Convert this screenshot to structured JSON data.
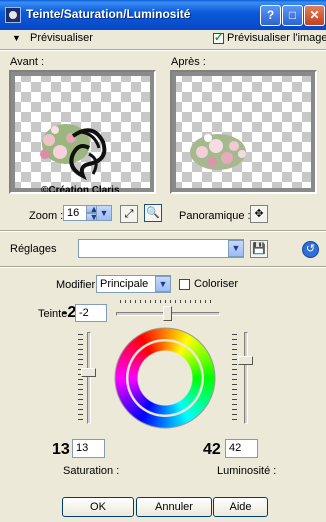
{
  "window": {
    "title": "Teinte/Saturation/Luminosité",
    "help": "?",
    "maximize": "□",
    "close": "✕"
  },
  "preview_bar": {
    "toggle_label": "Prévisualiser",
    "checkbox_label": "Prévisualiser l'image",
    "checked": true
  },
  "panels": {
    "before_label": "Avant :",
    "after_label": "Après :",
    "watermark": "©Création Claris"
  },
  "zoom": {
    "label": "Zoom :",
    "value": "16",
    "pan_label": "Panoramique :"
  },
  "presets": {
    "label": "Réglages",
    "value": ""
  },
  "modifier": {
    "label": "Modifier :",
    "value": "Principale",
    "colorize_label": "Coloriser",
    "colorize_checked": false
  },
  "hue": {
    "label": "Teinte",
    "big_value": "-2",
    "value": "-2",
    "level": -2
  },
  "saturation": {
    "big_value": "13",
    "value": "13",
    "label": "Saturation :",
    "level": 13
  },
  "lightness": {
    "big_value": "42",
    "value": "42",
    "label": "Luminosité :",
    "level": 42
  },
  "buttons": {
    "ok": "OK",
    "cancel": "Annuler",
    "help": "Aide"
  },
  "colors": {
    "titlebar": "#0B5CDB",
    "dialog_bg": "#ECE9D8",
    "border": "#7f9db9"
  }
}
